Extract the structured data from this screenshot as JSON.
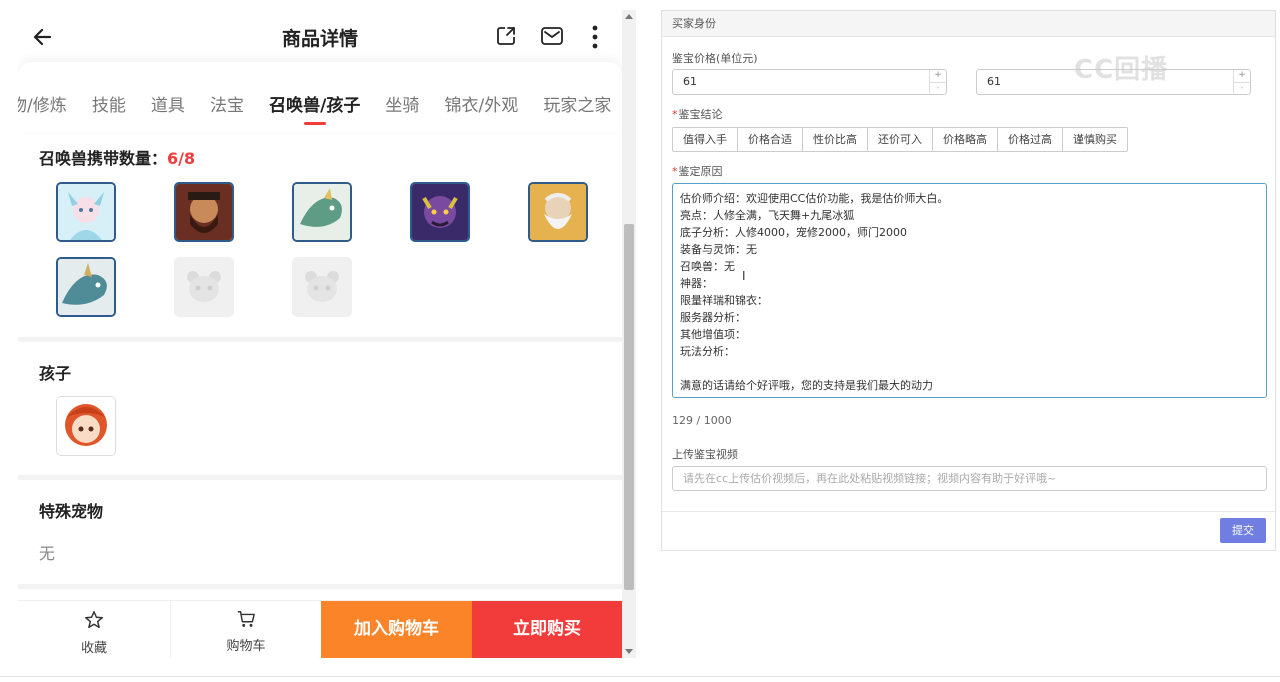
{
  "app": {
    "title": "商品详情",
    "tabs": [
      "物/修炼",
      "技能",
      "道具",
      "法宝",
      "召唤兽/孩子",
      "坐骑",
      "锦衣/外观",
      "玩家之家"
    ],
    "active_tab": "召唤兽/孩子"
  },
  "summons": {
    "label": "召唤兽携带数量：",
    "count": "6/8",
    "slots": [
      {
        "icon": "summon-cat-girl-avatar",
        "color": "#bfe4ef"
      },
      {
        "icon": "summon-warrior-avatar",
        "color": "#8a3a2a"
      },
      {
        "icon": "summon-dragon-avatar",
        "color": "#6fa88a"
      },
      {
        "icon": "summon-demon-avatar",
        "color": "#5a3a8a"
      },
      {
        "icon": "summon-elder-avatar",
        "color": "#d9a441"
      },
      {
        "icon": "summon-dragon-avatar",
        "color": "#5f98a0"
      },
      {
        "icon": "panda-placeholder-icon",
        "color": "#f0f0f0"
      },
      {
        "icon": "panda-placeholder-icon",
        "color": "#f0f0f0"
      }
    ]
  },
  "child": {
    "label": "孩子",
    "icon": "child-avatar"
  },
  "special_pet": {
    "label": "特殊宠物",
    "value": "无"
  },
  "bottom_bar": {
    "favorite": "收藏",
    "cart": "购物车",
    "add_to_cart": "加入购物车",
    "buy_now": "立即购买"
  },
  "form": {
    "header": "买家身份",
    "price_label": "鉴宝价格(单位元)",
    "price_min": "61",
    "price_max": "61",
    "watermark": "CC回播",
    "conclusion_label": "鉴宝结论",
    "conclusions": [
      "值得入手",
      "价格合适",
      "性价比高",
      "还价可入",
      "价格略高",
      "价格过高",
      "谨慎购买"
    ],
    "reason_label": "鉴定原因",
    "reason_lines": [
      "估价师介绍：欢迎使用CC估价功能，我是估价师大白。",
      "亮点：人修全满，飞天舞+九尾冰狐",
      "底子分析：人修4000，宠修2000，师门2000",
      "装备与灵饰：无",
      "召唤兽：无",
      "神器：",
      "限量祥瑞和锦衣：",
      "服务器分析：",
      "其他增值项：",
      "玩法分析：",
      "",
      "满意的话请给个好评哦，您的支持是我们最大的动力"
    ],
    "char_count": "129 / 1000",
    "video_label": "上传鉴宝视频",
    "video_placeholder": "请先在cc上传估价视频后，再在此处粘贴视频链接；视频内容有助于好评哦~",
    "submit": "提交"
  },
  "colors": {
    "accent_red": "#f03c3c",
    "add_cart_orange": "#fb8429",
    "submit_blue": "#6f7ee0",
    "pet_border": "#2f5b8a"
  }
}
